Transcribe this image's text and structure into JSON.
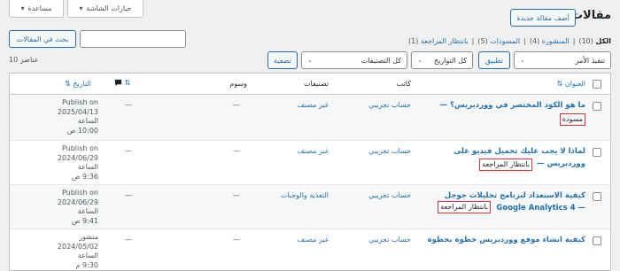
{
  "header": {
    "page_title": "مقالات",
    "add_new_label": "أضف مقالة جديدة",
    "screen_options_label": "خيارات الشاشة",
    "help_label": "مساعدة"
  },
  "filters": {
    "all": "الكل",
    "all_count": "(10)",
    "published": "المنشورة",
    "published_count": "(4)",
    "drafts": "المسودات",
    "drafts_count": "(5)",
    "pending": "بانتظار المراجعة",
    "pending_count": "(1)",
    "separator": "|"
  },
  "search": {
    "input_value": "",
    "button_label": "بحث في المقالات"
  },
  "bulk": {
    "bulk_action_value": "تنفيذ الأمر",
    "apply_label": "تطبيق",
    "dates_value": "كل التواريخ",
    "categories_value": "كل التصنيفات",
    "filter_label": "تصفية",
    "items_count": "10 عناصر"
  },
  "table": {
    "headers": {
      "title": "العنوان",
      "author": "كاتب",
      "categories": "تصنيفات",
      "tags": "وسوم",
      "comments_icon": "comment-icon",
      "date": "التاريخ"
    },
    "rows": [
      {
        "title_line1": "ما هو الكود المختصر في ووردبريس؟ —",
        "title_line2": "",
        "state": "مسودة",
        "author": "حساب تجريبي",
        "categories": "غير مصنف",
        "tags": "—",
        "comments": "—",
        "date_status": "Publish on",
        "date_value": "2025/04/13",
        "date_at": "الساعة",
        "date_time": "10:00 ص"
      },
      {
        "title_line1": "لماذا لا يجب عليك تحميل فيديو على",
        "title_line2": "ووردبريس —",
        "state": "بانتظار المراجعة",
        "author": "حساب تجريبي",
        "categories": "غير مصنف",
        "tags": "—",
        "comments": "—",
        "date_status": "Publish on",
        "date_value": "2024/06/29",
        "date_at": "الساعة",
        "date_time": "9:36 ص"
      },
      {
        "title_line1": "كيفية الاستعداد لبرنامج تحليلات جوجل",
        "title_line2": "Google Analytics 4 —",
        "state": "بانتظار المراجعة",
        "author": "حساب تجريبي",
        "categories": "التغذية والوجبات",
        "tags": "—",
        "comments": "—",
        "date_status": "Publish on",
        "date_value": "2024/06/29",
        "date_at": "الساعة",
        "date_time": "9:41 ص"
      },
      {
        "title_line1": "كيفية انشاء موقع ووردبريس خطوة بخطوة",
        "title_line2": "",
        "state": "",
        "author": "حساب تجريبي",
        "categories": "غير مصنف",
        "tags": "—",
        "comments": "—",
        "date_status": "منشور",
        "date_value": "2024/05/02",
        "date_at": "الساعة",
        "date_time": "9:30 م"
      }
    ]
  }
}
